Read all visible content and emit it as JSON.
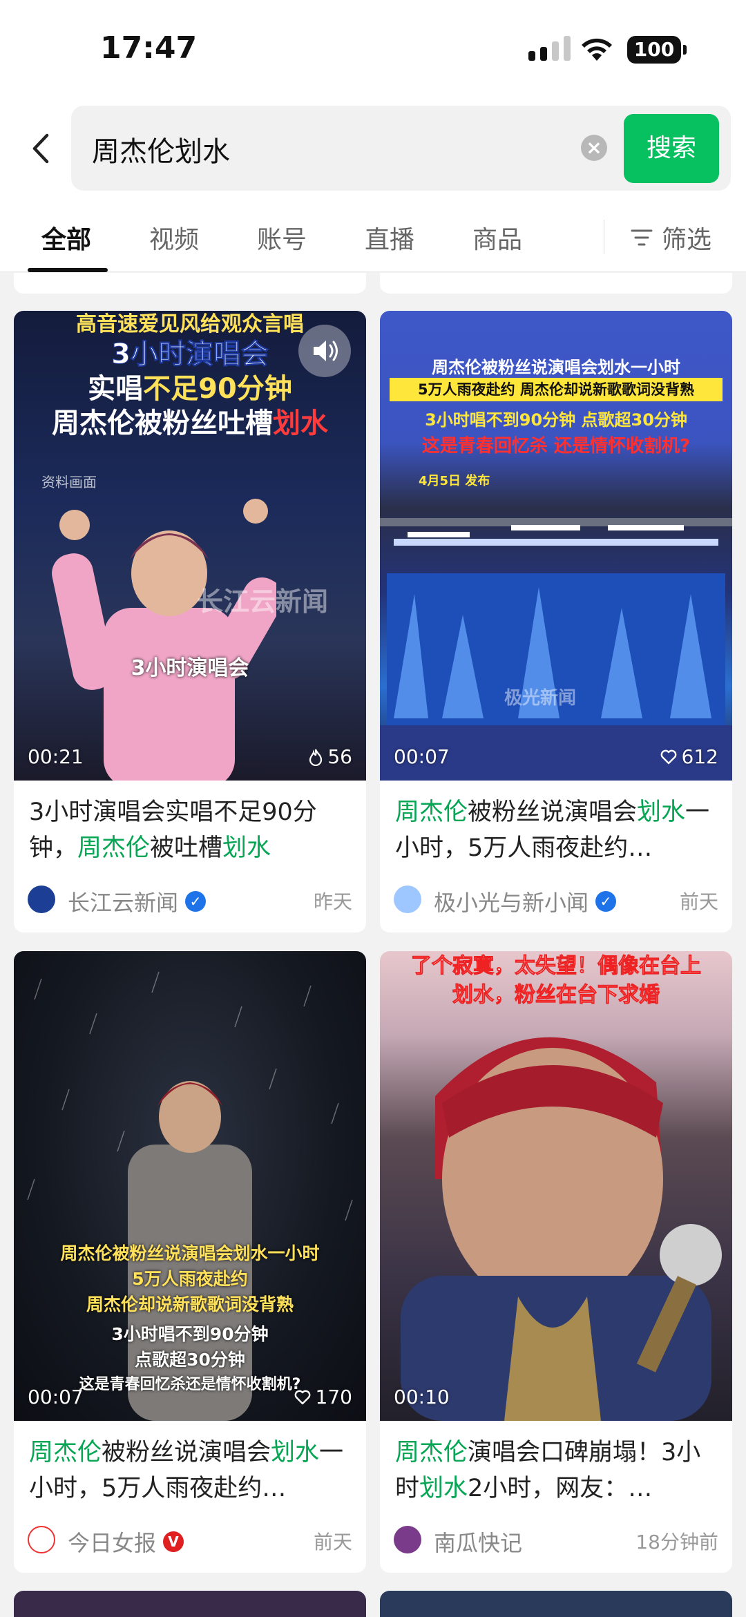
{
  "status": {
    "time": "17:47",
    "battery": "100"
  },
  "search": {
    "query": "周杰伦划水",
    "button": "搜索"
  },
  "tabs": [
    {
      "label": "全部"
    },
    {
      "label": "视频"
    },
    {
      "label": "账号"
    },
    {
      "label": "直播"
    },
    {
      "label": "商品"
    }
  ],
  "filter_label": "筛选",
  "cards": [
    {
      "overlay_top": "高音速爱见风给观众言唱",
      "overlay_lines": [
        "3小时演唱会",
        "实唱不足90分钟",
        "周杰伦被粉丝吐槽划水"
      ],
      "overlay_hint": "资料画面",
      "overlay_caption": "3小时演唱会",
      "watermark": "长江云新闻",
      "duration": "00:21",
      "likes": "56",
      "title_parts": [
        {
          "t": "3小时演唱会实唱不足90分钟，",
          "hl": false
        },
        {
          "t": "周杰伦",
          "hl": true
        },
        {
          "t": "被吐槽",
          "hl": false
        },
        {
          "t": "划水",
          "hl": true
        }
      ],
      "author": "长江云新闻",
      "time": "昨天"
    },
    {
      "overlay_lines": [
        "周杰伦被粉丝说演唱会划水一小时",
        "5万人雨夜赴约 周杰伦却说新歌歌词没背熟",
        "3小时唱不到90分钟 点歌超30分钟",
        "这是青春回忆杀 还是情怀收割机?"
      ],
      "overlay_date": "4月5日 发布",
      "watermark": "极光新闻",
      "duration": "00:07",
      "likes": "612",
      "title_parts": [
        {
          "t": "周杰伦",
          "hl": true
        },
        {
          "t": "被粉丝说演唱会",
          "hl": false
        },
        {
          "t": "划水",
          "hl": true
        },
        {
          "t": "一小时，5万人雨夜赴约…",
          "hl": false
        }
      ],
      "author": "极小光与新小闻",
      "time": "前天"
    },
    {
      "overlay_lines": [
        "周杰伦被粉丝说演唱会划水一小时",
        "5万人雨夜赴约",
        "周杰伦却说新歌歌词没背熟",
        "3小时唱不到90分钟",
        "点歌超30分钟",
        "这是青春回忆杀还是情怀收割机?"
      ],
      "duration": "00:07",
      "likes": "170",
      "title_parts": [
        {
          "t": "周杰伦",
          "hl": true
        },
        {
          "t": "被粉丝说演唱会",
          "hl": false
        },
        {
          "t": "划水",
          "hl": true
        },
        {
          "t": "一小时，5万人雨夜赴约…",
          "hl": false
        }
      ],
      "author": "今日女报",
      "time": "前天"
    },
    {
      "overlay_lines": [
        "了个寂寞，太失望！偶像在台上",
        "划水，粉丝在台下求婚"
      ],
      "duration": "00:10",
      "title_parts": [
        {
          "t": "周杰伦",
          "hl": true
        },
        {
          "t": "演唱会口碑崩塌！3小时",
          "hl": false
        },
        {
          "t": "划水",
          "hl": true
        },
        {
          "t": "2小时，网友：…",
          "hl": false
        }
      ],
      "author": "南瓜快记",
      "time": "18分钟前"
    }
  ]
}
